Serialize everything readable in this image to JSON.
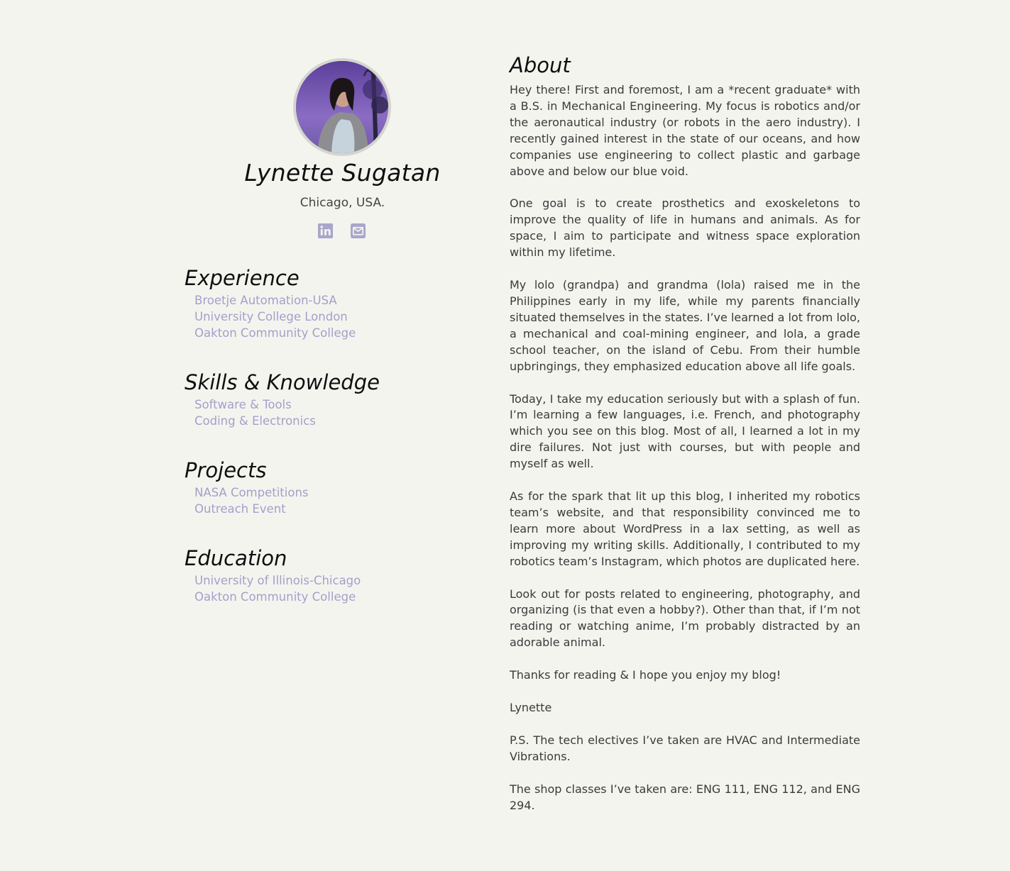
{
  "profile": {
    "name": "Lynette Sugatan",
    "location": "Chicago, USA.",
    "avatar_icon": "profile-photo",
    "social": [
      {
        "icon": "linkedin-icon",
        "color": "#a9a6cc"
      },
      {
        "icon": "email-icon",
        "color": "#a9a6cc"
      }
    ]
  },
  "sections": {
    "experience": {
      "title": "Experience",
      "items": [
        "Broetje Automation-USA",
        "University College London",
        "Oakton Community College"
      ]
    },
    "skills": {
      "title": "Skills & Knowledge",
      "items": [
        "Software & Tools",
        "Coding & Electronics"
      ]
    },
    "projects": {
      "title": "Projects",
      "items": [
        "NASA Competitions",
        "Outreach Event"
      ]
    },
    "education": {
      "title": "Education",
      "items": [
        "University of Illinois-Chicago",
        "Oakton Community College"
      ]
    }
  },
  "about": {
    "title": "About",
    "paragraphs": [
      "Hey there! First and foremost, I am a *recent graduate* with a B.S. in Mechanical Engineering. My focus is robotics and/or the aeronautical industry (or robots in the aero industry). I recently gained interest in the state of our oceans, and how companies use engineering to collect plastic and garbage above and below our blue void.",
      "One goal is to create prosthetics and exoskeletons to improve the quality of life in humans and animals. As for space, I aim to participate and witness space exploration within my lifetime.",
      "My lolo (grandpa) and grandma (lola) raised me in the Philippines early in my life, while my parents financially situated themselves in the states. I’ve learned a lot from lolo, a mechanical and coal-mining engineer, and lola, a grade school teacher, on the island of Cebu. From their humble upbringings, they emphasized education above all life goals.",
      "Today, I take my education seriously but with a splash of fun. I’m learning a few languages, i.e. French, and photography which you see on this blog. Most of all, I learned a lot in my dire failures. Not just with courses, but with people and myself as well.",
      "As for the spark that lit up this blog, I inherited my robotics team’s website, and that responsibility convinced me to learn more about WordPress in a lax setting, as well as improving my writing skills. Additionally, I contributed to my robotics team’s Instagram, which photos are duplicated here.",
      "Look out for posts related to engineering, photography, and organizing (is that even a hobby?). Other than that, if I’m not reading or watching anime, I’m probably distracted by an adorable animal.",
      "Thanks for reading & I hope you enjoy my blog!",
      "Lynette",
      "P.S. The tech electives I’ve taken are HVAC and Intermediate Vibrations.",
      "The shop classes I’ve taken are: ENG 111, ENG 112, and ENG 294."
    ]
  },
  "colors": {
    "background": "#f4f4ef",
    "link": "#a3a0c9",
    "heading": "#0f0f0f",
    "body_text": "#3a3a3a"
  }
}
